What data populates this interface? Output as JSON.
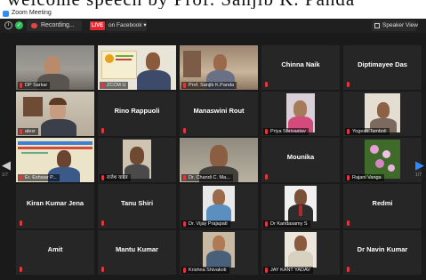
{
  "caption_fragment": "welcome speech by Prof. Sanjib K. Panda",
  "window": {
    "title": "Zoom Meeting"
  },
  "toolbar": {
    "recording_label": "Recording...",
    "live_badge": "LIVE",
    "live_target": "on Facebook",
    "view_label": "Speaker View",
    "icons": [
      "info-icon",
      "shield-icon",
      "record-icon",
      "grid-icon",
      "chevron-down-icon"
    ]
  },
  "pagination": {
    "left": "1/7",
    "right": "1/7"
  },
  "participants": [
    "DP Sarkar",
    "ZCCM U",
    "Prof. Sanjib K.Panda",
    "Chinna Naik",
    "Diptimayee Das",
    "alexr",
    "Rino Rappuoli",
    "Manaswini Rout",
    "Priya Shrivastav",
    "Yogesh Tamboli",
    "Er. Eshwar P...",
    "राजेश यादव",
    "Dr. Chandi C. Ma...",
    "Mounika",
    "Rajani Vanga",
    "Kiran Kumar Jena",
    "Tanu Shiri",
    "Dr. Vijay Prajapati",
    "Dr Kandasamy S",
    "Redmi",
    "Amit",
    "Mantu Kumar",
    "Krishna Shivakoti",
    "JAY KANT YADAV",
    "Dr Navin Kumar"
  ],
  "colors": {
    "active_border": "#8fe03c",
    "live_red": "#e8252c",
    "mute_red": "#e5363c",
    "nav_blue": "#2d8cff"
  }
}
